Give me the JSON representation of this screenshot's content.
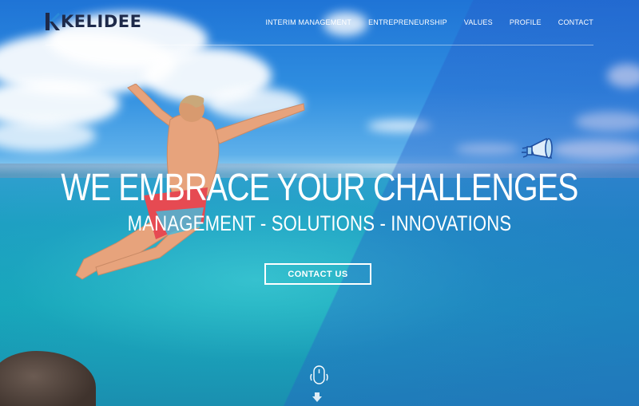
{
  "brand": {
    "name": "KELIDEE",
    "logo_icon": "kelidee-k-logo"
  },
  "nav": {
    "items": [
      {
        "label": "INTERIM MANAGEMENT"
      },
      {
        "label": "ENTREPRENEURSHIP"
      },
      {
        "label": "VALUES"
      },
      {
        "label": "PROFILE"
      },
      {
        "label": "CONTACT"
      }
    ]
  },
  "hero": {
    "headline": "WE EMBRACE YOUR CHALLENGES",
    "subline": "MANAGEMENT - SOLUTIONS - INNOVATIONS",
    "cta_label": "CONTACT US",
    "icons": [
      "megaphone-icon",
      "mouse-scroll-icon",
      "down-arrow-icon"
    ]
  },
  "colors": {
    "logo_dark": "#1e2a4a",
    "logo_blue": "#2a8ad8",
    "text": "#ffffff"
  }
}
